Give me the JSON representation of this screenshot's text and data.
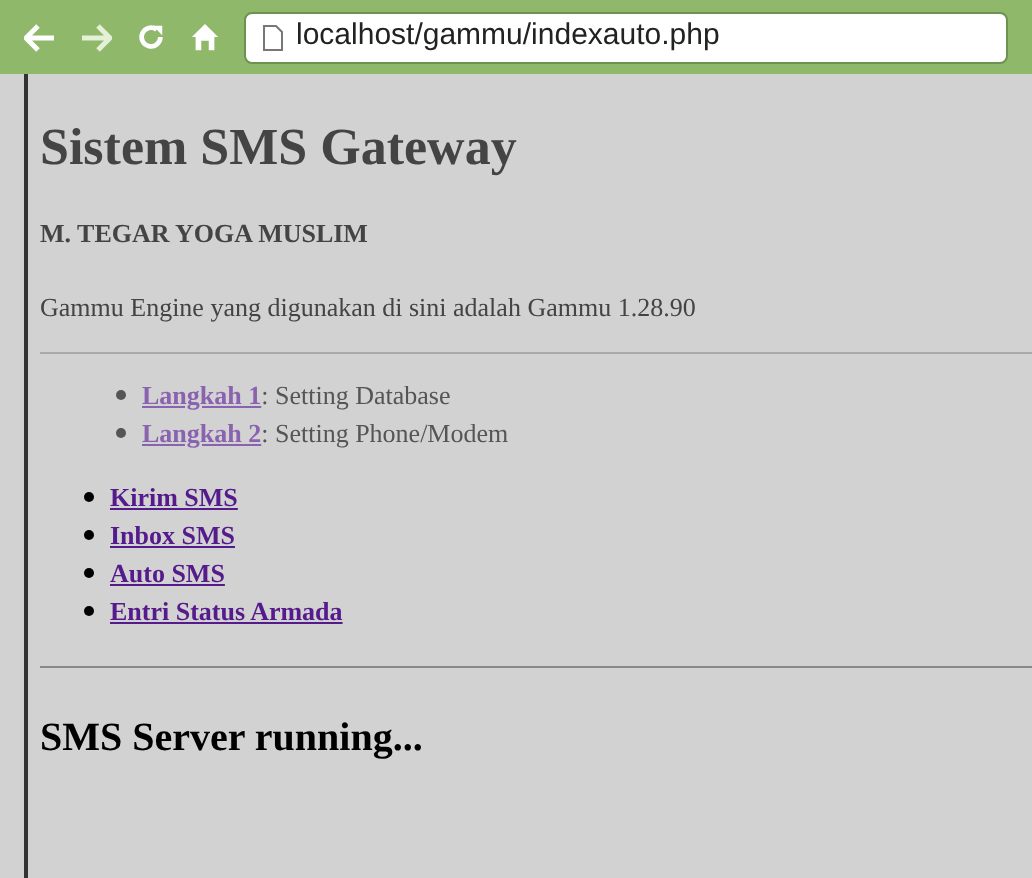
{
  "browser": {
    "address": "localhost/gammu/indexauto.php"
  },
  "page": {
    "title": "Sistem SMS Gateway",
    "author": "M. TEGAR YOGA MUSLIM",
    "engine_note": "Gammu Engine yang digunakan di sini adalah Gammu 1.28.90",
    "steps": [
      {
        "link": "Langkah 1",
        "text": ": Setting Database"
      },
      {
        "link": "Langkah 2",
        "text": ": Setting Phone/Modem"
      }
    ],
    "menu": [
      "Kirim SMS",
      "Inbox SMS",
      "Auto SMS",
      "Entri Status Armada"
    ],
    "status": "SMS Server running..."
  }
}
